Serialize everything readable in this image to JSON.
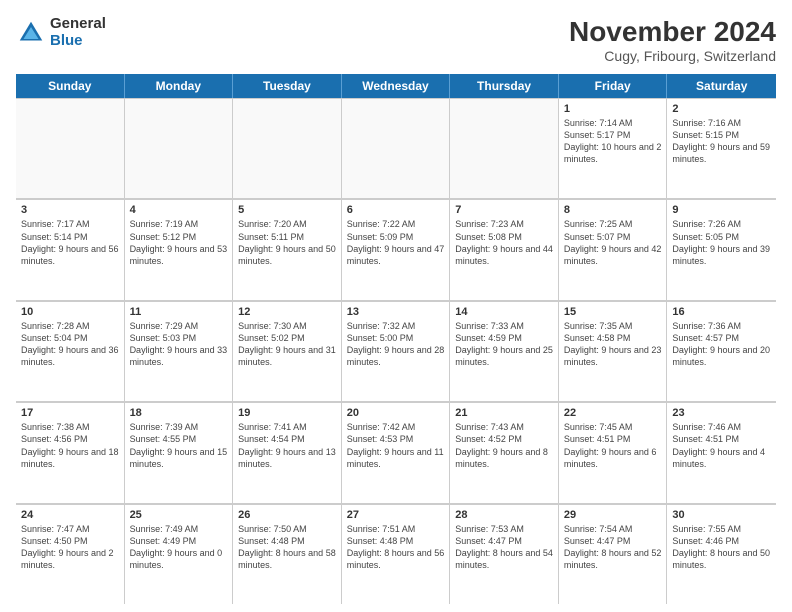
{
  "header": {
    "logo_general": "General",
    "logo_blue": "Blue",
    "title": "November 2024",
    "subtitle": "Cugy, Fribourg, Switzerland"
  },
  "days_of_week": [
    "Sunday",
    "Monday",
    "Tuesday",
    "Wednesday",
    "Thursday",
    "Friday",
    "Saturday"
  ],
  "weeks": [
    [
      {
        "day": "",
        "info": ""
      },
      {
        "day": "",
        "info": ""
      },
      {
        "day": "",
        "info": ""
      },
      {
        "day": "",
        "info": ""
      },
      {
        "day": "",
        "info": ""
      },
      {
        "day": "1",
        "info": "Sunrise: 7:14 AM\nSunset: 5:17 PM\nDaylight: 10 hours and 2 minutes."
      },
      {
        "day": "2",
        "info": "Sunrise: 7:16 AM\nSunset: 5:15 PM\nDaylight: 9 hours and 59 minutes."
      }
    ],
    [
      {
        "day": "3",
        "info": "Sunrise: 7:17 AM\nSunset: 5:14 PM\nDaylight: 9 hours and 56 minutes."
      },
      {
        "day": "4",
        "info": "Sunrise: 7:19 AM\nSunset: 5:12 PM\nDaylight: 9 hours and 53 minutes."
      },
      {
        "day": "5",
        "info": "Sunrise: 7:20 AM\nSunset: 5:11 PM\nDaylight: 9 hours and 50 minutes."
      },
      {
        "day": "6",
        "info": "Sunrise: 7:22 AM\nSunset: 5:09 PM\nDaylight: 9 hours and 47 minutes."
      },
      {
        "day": "7",
        "info": "Sunrise: 7:23 AM\nSunset: 5:08 PM\nDaylight: 9 hours and 44 minutes."
      },
      {
        "day": "8",
        "info": "Sunrise: 7:25 AM\nSunset: 5:07 PM\nDaylight: 9 hours and 42 minutes."
      },
      {
        "day": "9",
        "info": "Sunrise: 7:26 AM\nSunset: 5:05 PM\nDaylight: 9 hours and 39 minutes."
      }
    ],
    [
      {
        "day": "10",
        "info": "Sunrise: 7:28 AM\nSunset: 5:04 PM\nDaylight: 9 hours and 36 minutes."
      },
      {
        "day": "11",
        "info": "Sunrise: 7:29 AM\nSunset: 5:03 PM\nDaylight: 9 hours and 33 minutes."
      },
      {
        "day": "12",
        "info": "Sunrise: 7:30 AM\nSunset: 5:02 PM\nDaylight: 9 hours and 31 minutes."
      },
      {
        "day": "13",
        "info": "Sunrise: 7:32 AM\nSunset: 5:00 PM\nDaylight: 9 hours and 28 minutes."
      },
      {
        "day": "14",
        "info": "Sunrise: 7:33 AM\nSunset: 4:59 PM\nDaylight: 9 hours and 25 minutes."
      },
      {
        "day": "15",
        "info": "Sunrise: 7:35 AM\nSunset: 4:58 PM\nDaylight: 9 hours and 23 minutes."
      },
      {
        "day": "16",
        "info": "Sunrise: 7:36 AM\nSunset: 4:57 PM\nDaylight: 9 hours and 20 minutes."
      }
    ],
    [
      {
        "day": "17",
        "info": "Sunrise: 7:38 AM\nSunset: 4:56 PM\nDaylight: 9 hours and 18 minutes."
      },
      {
        "day": "18",
        "info": "Sunrise: 7:39 AM\nSunset: 4:55 PM\nDaylight: 9 hours and 15 minutes."
      },
      {
        "day": "19",
        "info": "Sunrise: 7:41 AM\nSunset: 4:54 PM\nDaylight: 9 hours and 13 minutes."
      },
      {
        "day": "20",
        "info": "Sunrise: 7:42 AM\nSunset: 4:53 PM\nDaylight: 9 hours and 11 minutes."
      },
      {
        "day": "21",
        "info": "Sunrise: 7:43 AM\nSunset: 4:52 PM\nDaylight: 9 hours and 8 minutes."
      },
      {
        "day": "22",
        "info": "Sunrise: 7:45 AM\nSunset: 4:51 PM\nDaylight: 9 hours and 6 minutes."
      },
      {
        "day": "23",
        "info": "Sunrise: 7:46 AM\nSunset: 4:51 PM\nDaylight: 9 hours and 4 minutes."
      }
    ],
    [
      {
        "day": "24",
        "info": "Sunrise: 7:47 AM\nSunset: 4:50 PM\nDaylight: 9 hours and 2 minutes."
      },
      {
        "day": "25",
        "info": "Sunrise: 7:49 AM\nSunset: 4:49 PM\nDaylight: 9 hours and 0 minutes."
      },
      {
        "day": "26",
        "info": "Sunrise: 7:50 AM\nSunset: 4:48 PM\nDaylight: 8 hours and 58 minutes."
      },
      {
        "day": "27",
        "info": "Sunrise: 7:51 AM\nSunset: 4:48 PM\nDaylight: 8 hours and 56 minutes."
      },
      {
        "day": "28",
        "info": "Sunrise: 7:53 AM\nSunset: 4:47 PM\nDaylight: 8 hours and 54 minutes."
      },
      {
        "day": "29",
        "info": "Sunrise: 7:54 AM\nSunset: 4:47 PM\nDaylight: 8 hours and 52 minutes."
      },
      {
        "day": "30",
        "info": "Sunrise: 7:55 AM\nSunset: 4:46 PM\nDaylight: 8 hours and 50 minutes."
      }
    ]
  ]
}
